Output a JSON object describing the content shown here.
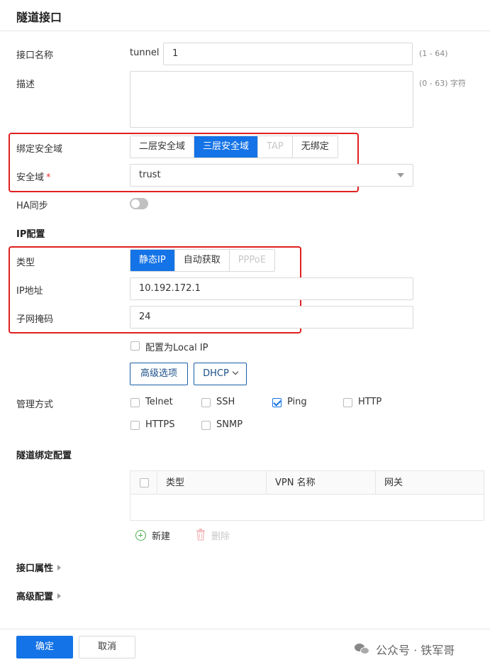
{
  "header": {
    "title": "隧道接口"
  },
  "fields": {
    "name": {
      "label": "接口名称",
      "prefix": "tunnel",
      "value": "1",
      "hint": "(1 - 64)"
    },
    "description": {
      "label": "描述",
      "value": "",
      "hint": "(0 - 63) 字符"
    },
    "bind_zone": {
      "label": "绑定安全域",
      "options": [
        "二层安全域",
        "三层安全域",
        "TAP",
        "无绑定"
      ],
      "selected": "三层安全域"
    },
    "zone": {
      "label": "安全域",
      "required_mark": "*",
      "value": "trust"
    },
    "ha_sync": {
      "label": "HA同步",
      "enabled": false
    }
  },
  "ip_config": {
    "section_title": "IP配置",
    "type": {
      "label": "类型",
      "options": [
        "静态IP",
        "自动获取",
        "PPPoE"
      ],
      "selected": "静态IP"
    },
    "ip_address": {
      "label": "IP地址",
      "value": "10.192.172.1"
    },
    "netmask": {
      "label": "子网掩码",
      "value": "24"
    },
    "local_ip": {
      "label": "配置为Local IP",
      "checked": false
    },
    "advanced_button": "高级选项",
    "dhcp_button": "DHCP"
  },
  "management": {
    "label": "管理方式",
    "options": [
      {
        "label": "Telnet",
        "checked": false
      },
      {
        "label": "SSH",
        "checked": false
      },
      {
        "label": "Ping",
        "checked": true
      },
      {
        "label": "HTTP",
        "checked": false
      },
      {
        "label": "HTTPS",
        "checked": false
      },
      {
        "label": "SNMP",
        "checked": false
      }
    ]
  },
  "tunnel_binding": {
    "section_title": "隧道绑定配置",
    "columns": [
      "类型",
      "VPN 名称",
      "网关"
    ],
    "rows": [],
    "add_label": "新建",
    "delete_label": "删除"
  },
  "collapsibles": {
    "interface_props": "接口属性",
    "advanced_config": "高级配置"
  },
  "footer": {
    "ok": "确定",
    "cancel": "取消",
    "watermark": "公众号 · 铁军哥"
  },
  "colors": {
    "primary": "#1473e6",
    "highlight_box": "#e02020"
  }
}
